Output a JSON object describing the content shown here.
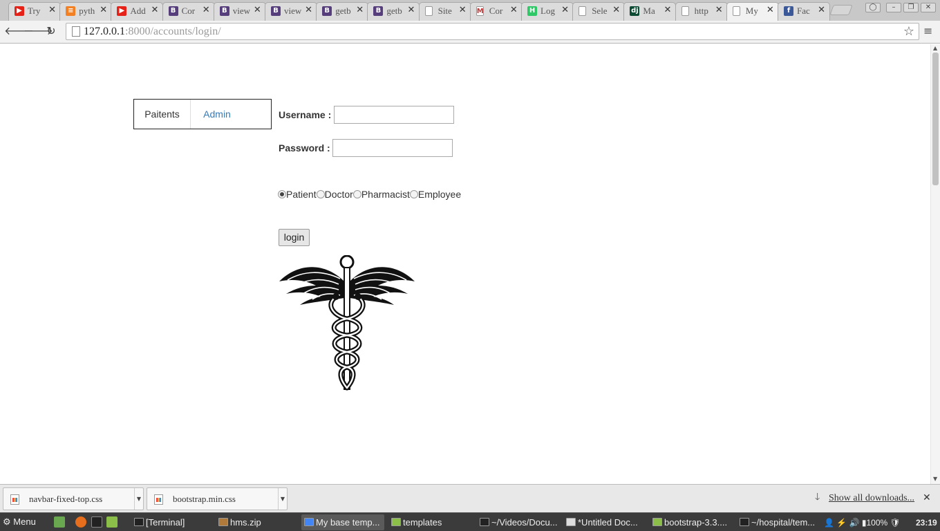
{
  "browser": {
    "tabs": [
      {
        "title": "Try",
        "favicon": "youtube-icon",
        "color": "#e62117",
        "glyph": "▶"
      },
      {
        "title": "pyth",
        "favicon": "stackoverflow-icon",
        "color": "#f48024",
        "glyph": "≡"
      },
      {
        "title": "Add",
        "favicon": "youtube-icon",
        "color": "#e62117",
        "glyph": "▶"
      },
      {
        "title": "Cor",
        "favicon": "bootstrap-icon",
        "color": "#563d7c",
        "glyph": "B"
      },
      {
        "title": "view",
        "favicon": "bootstrap-icon",
        "color": "#563d7c",
        "glyph": "B"
      },
      {
        "title": "view",
        "favicon": "bootstrap-icon",
        "color": "#563d7c",
        "glyph": "B"
      },
      {
        "title": "getb",
        "favicon": "bootstrap-icon",
        "color": "#563d7c",
        "glyph": "B"
      },
      {
        "title": "getb",
        "favicon": "bootstrap-icon",
        "color": "#563d7c",
        "glyph": "B"
      },
      {
        "title": "Site",
        "favicon": "page-icon",
        "color": "#ffffff",
        "glyph": ""
      },
      {
        "title": "Cor",
        "favicon": "gmail-icon",
        "color": "#ffffff",
        "glyph": "M"
      },
      {
        "title": "Log",
        "favicon": "hackerrank-icon",
        "color": "#2ec866",
        "glyph": "H"
      },
      {
        "title": "Sele",
        "favicon": "page-icon",
        "color": "#ffffff",
        "glyph": ""
      },
      {
        "title": "Ma",
        "favicon": "django-icon",
        "color": "#0c4b33",
        "glyph": "dj"
      },
      {
        "title": "http",
        "favicon": "page-icon",
        "color": "#ffffff",
        "glyph": ""
      },
      {
        "title": "My",
        "favicon": "page-icon",
        "color": "#ffffff",
        "glyph": "",
        "active": true
      },
      {
        "title": "Fac",
        "favicon": "facebook-icon",
        "color": "#3b5998",
        "glyph": "f"
      }
    ],
    "url_host": "127.0.0.1",
    "url_rest": ":8000/accounts/login/"
  },
  "page": {
    "tabs": {
      "patients": "Paitents",
      "admin": "Admin"
    },
    "username_label": "Username :",
    "password_label": "Password :",
    "username_value": "",
    "password_value": "",
    "roles": [
      {
        "label": "Patient",
        "checked": true
      },
      {
        "label": "Doctor",
        "checked": false
      },
      {
        "label": "Pharmacist",
        "checked": false
      },
      {
        "label": "Employee",
        "checked": false
      }
    ],
    "login_label": "login",
    "accent_link_color": "#337ab7"
  },
  "downloads": {
    "items": [
      "navbar-fixed-top.css",
      "bootstrap.min.css"
    ],
    "show_all": "Show all downloads..."
  },
  "taskbar": {
    "menu_label": "Menu",
    "tasks": [
      {
        "label": "[Terminal]",
        "icon": "terminal-icon",
        "color": "#222222"
      },
      {
        "label": "hms.zip",
        "icon": "archive-icon",
        "color": "#b07a3a"
      },
      {
        "label": "My base temp...",
        "icon": "chrome-icon",
        "color": "#4285f4",
        "active": true
      },
      {
        "label": "templates",
        "icon": "folder-icon",
        "color": "#8bbf4a"
      },
      {
        "label": "~/Videos/Docu...",
        "icon": "terminal-icon",
        "color": "#222222"
      },
      {
        "label": "*Untitled Doc...",
        "icon": "text-editor-icon",
        "color": "#dddddd"
      },
      {
        "label": "bootstrap-3.3....",
        "icon": "folder-icon",
        "color": "#8bbf4a"
      },
      {
        "label": "~/hospital/tem...",
        "icon": "terminal-icon",
        "color": "#222222"
      }
    ],
    "battery": "100%",
    "time": "23:19"
  }
}
